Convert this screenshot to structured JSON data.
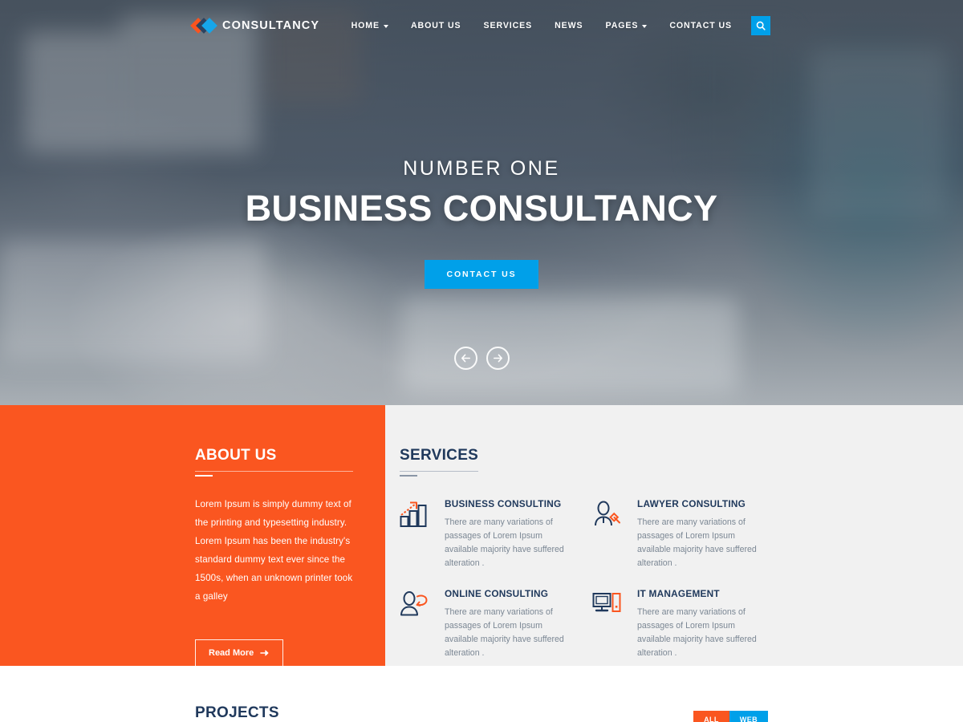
{
  "header": {
    "brand": "CONSULTANCY",
    "logo_colors": {
      "orange": "#f9541f",
      "navy": "#2c4360",
      "blue": "#16a6ea"
    },
    "nav": [
      {
        "label": "HOME",
        "has_dropdown": true
      },
      {
        "label": "ABOUT US",
        "has_dropdown": false
      },
      {
        "label": "SERVICES",
        "has_dropdown": false
      },
      {
        "label": "NEWS",
        "has_dropdown": false
      },
      {
        "label": "PAGES",
        "has_dropdown": true
      },
      {
        "label": "CONTACT US",
        "has_dropdown": false
      }
    ],
    "search_icon": "search-icon",
    "search_bg": "#00a0e9"
  },
  "hero": {
    "subtitle": "NUMBER ONE",
    "title": "BUSINESS CONSULTANCY",
    "cta_label": "CONTACT US",
    "cta_bg": "#00a0e9",
    "prev_icon": "arrow-left-icon",
    "next_icon": "arrow-right-icon"
  },
  "about": {
    "title": "ABOUT US",
    "bg": "#fa5620",
    "body": "Lorem Ipsum is simply dummy text of the printing and typesetting industry. Lorem Ipsum has been the industry's standard dummy text ever since the 1500s, when an unknown printer took a galley",
    "button_label": "Read More"
  },
  "services": {
    "title": "SERVICES",
    "accent": "#20395c",
    "items": [
      {
        "icon": "bar-chart-growth-icon",
        "name": "BUSINESS CONSULTING",
        "desc": "There are many variations of passages of Lorem Ipsum available majority have suffered alteration ."
      },
      {
        "icon": "lawyer-gavel-icon",
        "name": "LAWYER CONSULTING",
        "desc": "There are many variations of passages of Lorem Ipsum available majority have suffered alteration ."
      },
      {
        "icon": "person-chat-icon",
        "name": "ONLINE CONSULTING",
        "desc": "There are many variations of passages of Lorem Ipsum available majority have suffered alteration ."
      },
      {
        "icon": "desktop-server-icon",
        "name": "IT MANAGEMENT",
        "desc": "There are many variations of passages of Lorem Ipsum available majority have suffered alteration ."
      }
    ]
  },
  "projects": {
    "title": "PROJECTS",
    "filters": [
      {
        "label": "ALL",
        "color": "#fa5620"
      },
      {
        "label": "WEB",
        "color": "#00a0e9"
      }
    ]
  }
}
